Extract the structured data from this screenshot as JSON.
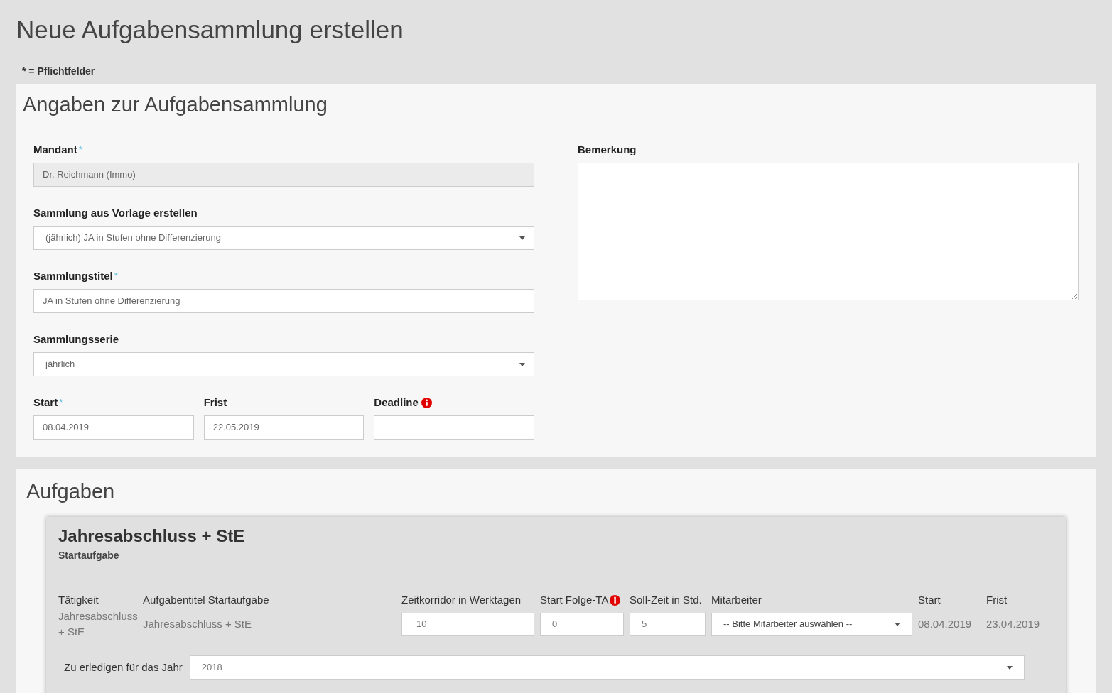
{
  "page_title": "Neue Aufgabensammlung erstellen",
  "required_note": "* = Pflichtfelder",
  "details": {
    "title": "Angaben zur Aufgabensammlung",
    "fields": [
      {
        "kind": "text",
        "label": "Mandant",
        "required_mark": "*",
        "value": "Dr. Reichmann (Immo)",
        "disabled": true
      },
      {
        "kind": "select",
        "label": "Sammlung aus Vorlage erstellen",
        "value": "(jährlich) JA in Stufen ohne Differenzierung",
        "disabled": false
      },
      {
        "kind": "text",
        "label": "Sammlungstitel",
        "required_mark": "*",
        "value": "JA in Stufen ohne Differenzierung",
        "disabled": false
      },
      {
        "kind": "select",
        "label": "Sammlungsserie",
        "value": "jährlich",
        "disabled": false
      }
    ],
    "date_fields": [
      {
        "label": "Start",
        "required_mark": "*",
        "info": false,
        "value": "08.04.2019"
      },
      {
        "label": "Frist",
        "info": false,
        "value": "22.05.2019"
      },
      {
        "label": "Deadline",
        "info": true
      }
    ],
    "remark": {
      "label": "Bemerkung"
    }
  },
  "tasks": {
    "title": "Aufgaben",
    "items": [
      {
        "title": "Jahresabschluss + StE",
        "subtitle": "Startaufgabe",
        "columns": [
          {
            "label": "Tätigkeit",
            "info": false
          },
          {
            "label": "Aufgabentitel Startaufgabe",
            "info": false
          },
          {
            "label": "Zeitkorridor in Werktagen",
            "info": false
          },
          {
            "label": "Start Folge-TA",
            "info": true
          },
          {
            "label": "Soll-Zeit in Std.",
            "info": false
          },
          {
            "label": "Mitarbeiter",
            "info": false
          },
          {
            "label": "Start",
            "info": false
          },
          {
            "label": "Frist",
            "info": false
          }
        ],
        "activity": "Jahresabschluss + StE",
        "task_title": "Jahresabschluss + StE",
        "time_corridor": "10",
        "start_next": "0",
        "target_hours": "5",
        "employee_placeholder": "-- Bitte Mitarbeiter auswählen --",
        "start": "08.04.2019",
        "deadline": "23.04.2019",
        "year_label": "Zu erledigen für das Jahr",
        "year": "2018"
      }
    ]
  }
}
